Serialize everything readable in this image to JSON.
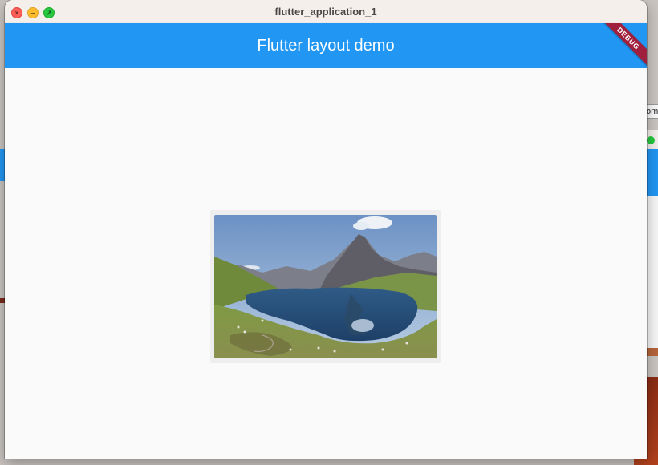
{
  "window": {
    "title": "flutter_application_1",
    "controls": [
      "close",
      "minimize",
      "maximize"
    ]
  },
  "appbar": {
    "title": "Flutter layout demo",
    "color": "#2196f3"
  },
  "debug_banner": {
    "label": "DEBUG",
    "color": "#a01f3c"
  },
  "content": {
    "image": {
      "icon": "mountain-lake-image"
    }
  },
  "background": {
    "partial_text": "om"
  }
}
